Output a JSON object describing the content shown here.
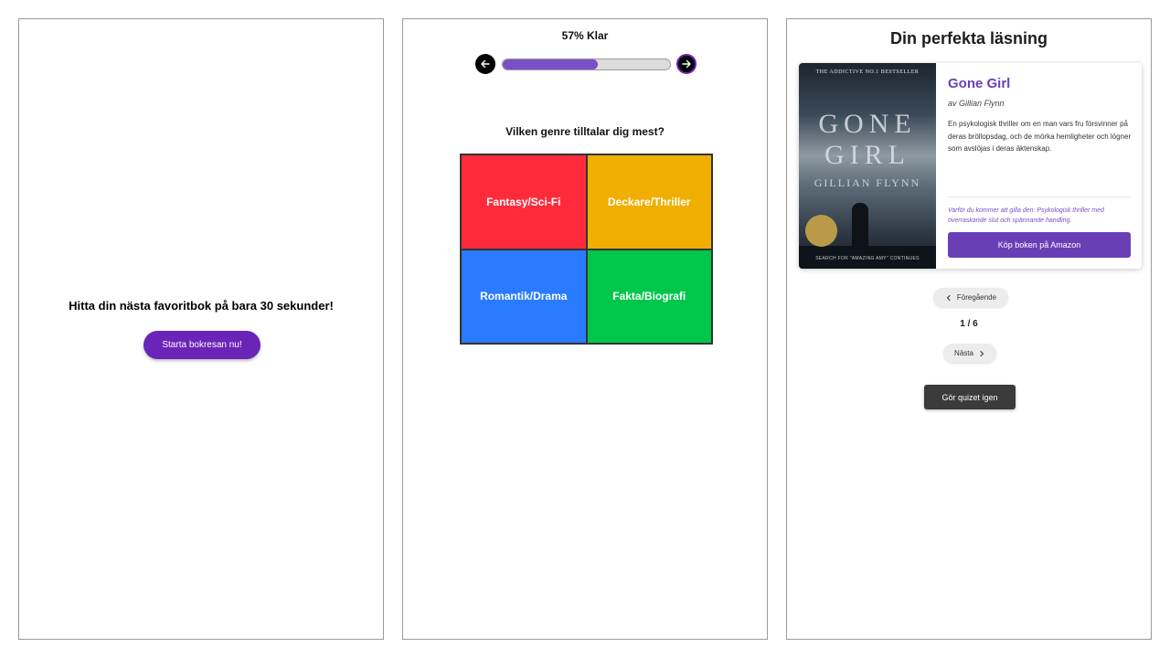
{
  "start_screen": {
    "headline": "Hitta din nästa favoritbok på bara 30 sekunder!",
    "start_label": "Starta bokresan nu!"
  },
  "quiz_screen": {
    "progress_label": "57% Klar",
    "progress_fraction": 0.57,
    "prev_icon": "arrow-left-icon",
    "next_icon": "arrow-right-icon",
    "question": "Vilken genre tilltalar dig mest?",
    "options": [
      {
        "label": "Fantasy/Sci-Fi",
        "color": "#ff2b3a"
      },
      {
        "label": "Deckare/Thriller",
        "color": "#f0ae00"
      },
      {
        "label": "Romantik/Drama",
        "color": "#2a7bff"
      },
      {
        "label": "Fakta/Biografi",
        "color": "#00c74a"
      }
    ]
  },
  "result_screen": {
    "title": "Din perfekta läsning",
    "book": {
      "title": "Gone Girl",
      "author": "av Gillian Flynn",
      "description": "En psykologisk thriller om en man vars fru försvinner på deras bröllopsdag, och de mörka hemligheter och lögner som avslöjas i deras äktenskap.",
      "reason": "Varför du kommer att gilla den: Psykologisk thriller med överraskande slut och spännande handling.",
      "buy_label": "Köp boken på Amazon",
      "cover": {
        "tagline": "THE ADDICTIVE NO.1 BESTSELLER",
        "title": "GONE GIRL",
        "author": "GILLIAN FLYNN",
        "footer": "SEARCH FOR \"AMAZING AMY\" CONTINUES"
      }
    },
    "prev_label": "Föregående",
    "page_indicator": "1 / 6",
    "next_label": "Nästa",
    "retake_label": "Gör quizet igen"
  },
  "colors": {
    "accent_purple": "#6a24b8",
    "progress_fill": "#7a4fc8",
    "book_title": "#6a3fb5",
    "retake_button": "#3b3b3b"
  }
}
